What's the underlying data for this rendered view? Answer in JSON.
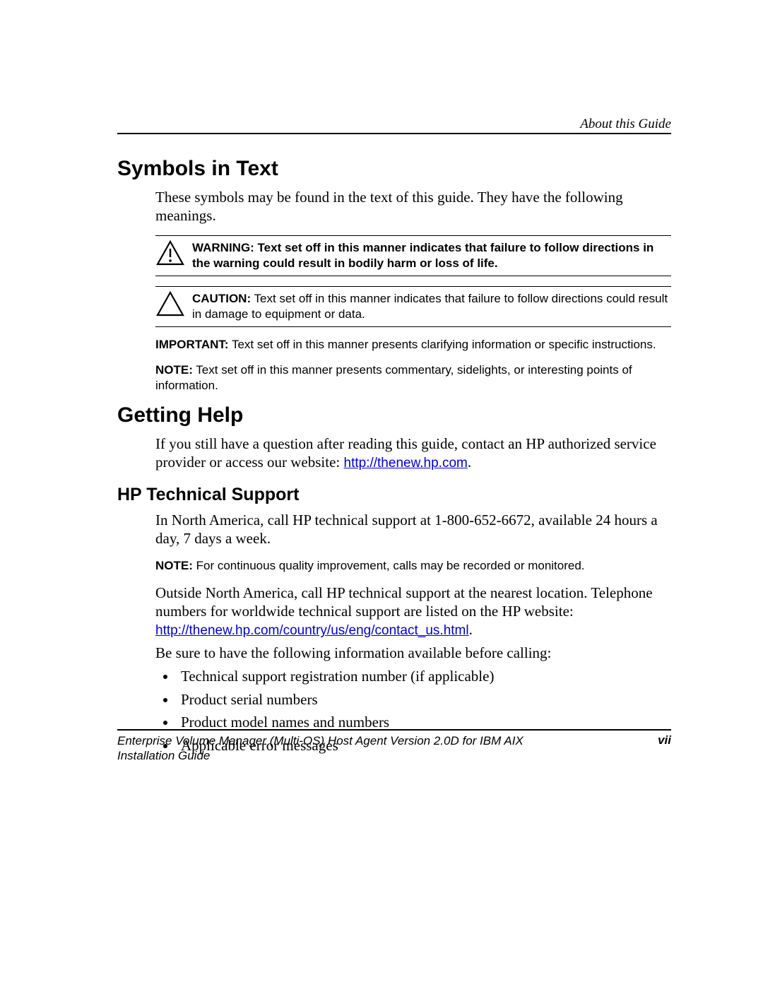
{
  "header": {
    "section": "About this Guide"
  },
  "symbols": {
    "heading": "Symbols in Text",
    "intro": "These symbols may be found in the text of this guide. They have the following meanings.",
    "warning_label": "WARNING:",
    "warning_text": " Text set off in this manner indicates that failure to follow directions in the warning could result in bodily harm or loss of life.",
    "caution_label": "CAUTION:",
    "caution_text": " Text set off in this manner indicates that failure to follow directions could result in damage to equipment or data.",
    "important_label": "IMPORTANT:",
    "important_text": " Text set off in this manner presents clarifying information or specific instructions.",
    "note_label": "NOTE:",
    "note_text": " Text set off in this manner presents commentary, sidelights, or interesting points of information."
  },
  "help": {
    "heading": "Getting Help",
    "intro_pre": "If you still have a question after reading this guide, contact an HP authorized service provider or access our website: ",
    "intro_link": "http://thenew.hp.com",
    "intro_post": "."
  },
  "tech": {
    "heading": "HP Technical Support",
    "na": "In North America, call HP technical support at 1-800-652-6672, available 24 hours a day, 7 days a week.",
    "note_label": "NOTE:",
    "note_text": " For continuous quality improvement, calls may be recorded or monitored.",
    "outside_pre": "Outside North America, call HP technical support at the nearest location. Telephone numbers for worldwide technical support are listed on the HP website: ",
    "outside_link": "http://thenew.hp.com/country/us/eng/contact_us.html",
    "outside_post": ".",
    "before": "Be sure to have the following information available before calling:",
    "items": [
      "Technical support registration number (if applicable)",
      "Product serial numbers",
      "Product model names and numbers",
      "Applicable error messages"
    ]
  },
  "footer": {
    "left1": "Enterprise Volume Manager (Multi-OS) Host Agent Version 2.0D for IBM AIX",
    "left2": "Installation Guide",
    "page": "vii"
  }
}
